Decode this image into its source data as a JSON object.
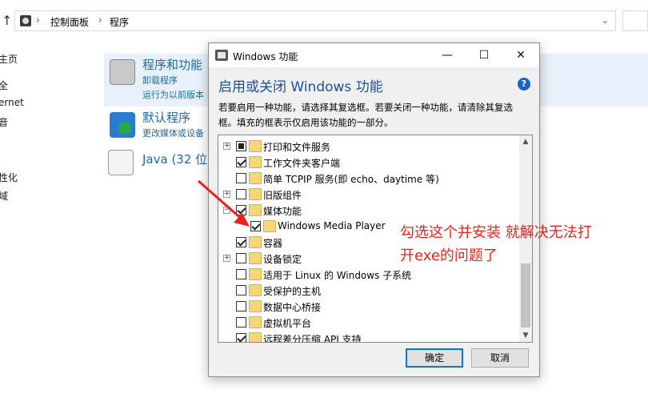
{
  "explorer": {
    "address_crumbs": [
      "控制面板",
      "程序"
    ],
    "left_nav": [
      "主页",
      "全",
      "ernet",
      "音",
      "",
      "性化",
      "域"
    ],
    "categories": [
      {
        "title": "程序和功能",
        "links": [
          "卸载程序",
          "运行为以前版本"
        ]
      },
      {
        "title": "默认程序",
        "links": [
          "更改媒体或设备"
        ]
      },
      {
        "title": "Java (32 位",
        "links": []
      }
    ]
  },
  "dialog": {
    "title": "Windows 功能",
    "minimize": "—",
    "maximize": "☐",
    "close": "✕",
    "heading": "启用或关闭 Windows 功能",
    "help": "?",
    "description": "若要启用一种功能，请选择其复选框。若要关闭一种功能，请清除其复选框。填充的框表示仅启用该功能的一部分。",
    "features": [
      {
        "label": "打印和文件服务",
        "state": "partial",
        "expandable": true
      },
      {
        "label": "工作文件夹客户端",
        "state": "checked",
        "expandable": false
      },
      {
        "label": "简单 TCPIP 服务(即 echo、daytime 等)",
        "state": "unchecked",
        "expandable": false
      },
      {
        "label": "旧版组件",
        "state": "unchecked",
        "expandable": true
      },
      {
        "label": "媒体功能",
        "state": "checked",
        "expandable": true
      },
      {
        "label": "Windows Media Player",
        "state": "checked",
        "expandable": false
      },
      {
        "label": "容器",
        "state": "checked",
        "expandable": false
      },
      {
        "label": "设备锁定",
        "state": "unchecked",
        "expandable": true
      },
      {
        "label": "适用于 Linux 的 Windows 子系统",
        "state": "unchecked",
        "expandable": false
      },
      {
        "label": "受保护的主机",
        "state": "unchecked",
        "expandable": false
      },
      {
        "label": "数据中心桥接",
        "state": "unchecked",
        "expandable": false
      },
      {
        "label": "虚拟机平台",
        "state": "unchecked",
        "expandable": false
      },
      {
        "label": "远程差分压缩 API 支持",
        "state": "checked",
        "expandable": false
      }
    ],
    "ok_label": "确定",
    "cancel_label": "取消"
  },
  "annotation": {
    "line1": "勾选这个并安装  就解决无法打",
    "line2": "开exe的问题了",
    "color": "#e8231f"
  }
}
